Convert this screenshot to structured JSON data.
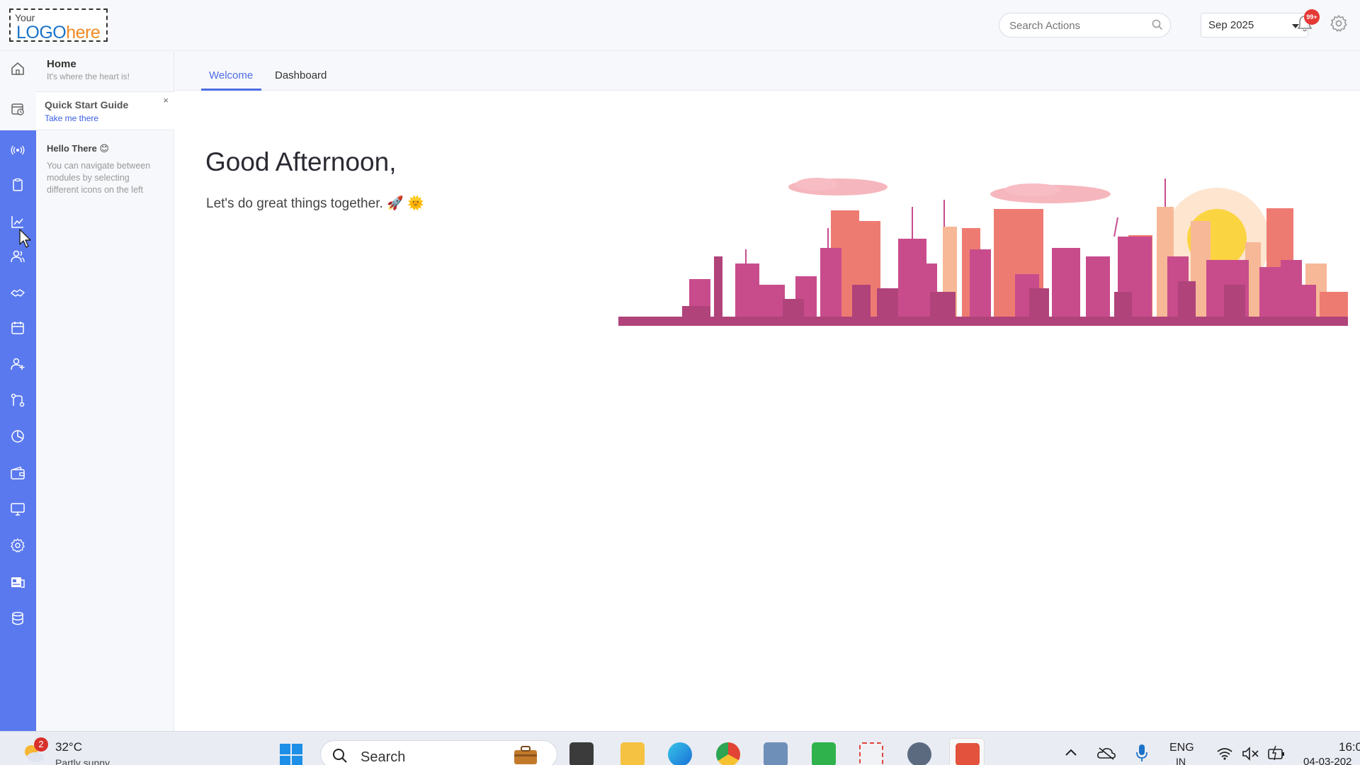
{
  "header": {
    "logo": {
      "line1": "Your",
      "logo_word": "LOGO",
      "logo_suffix": "here"
    },
    "search_placeholder": "Search Actions",
    "month": "Sep 2025",
    "notification_count": "99+"
  },
  "side_panel": {
    "home_title": "Home",
    "home_subtitle": "It's where the heart is!",
    "quick_start_title": "Quick Start Guide",
    "quick_start_link": "Take me there",
    "close_symbol": "×",
    "hello_title": "Hello There 😊",
    "hello_text": "You can navigate between modules by selecting different icons on the left"
  },
  "rail_icons": [
    "home-icon",
    "calendar-clock-icon",
    "broadcast-icon",
    "clipboard-icon",
    "line-chart-icon",
    "users-icon",
    "handshake-icon",
    "calendar-icon",
    "add-user-icon",
    "workflow-icon",
    "pie-chart-icon",
    "wallet-icon",
    "monitor-icon",
    "settings-cog-icon",
    "news-icon",
    "database-icon"
  ],
  "tabs": {
    "welcome": "Welcome",
    "dashboard": "Dashboard"
  },
  "main": {
    "greeting": "Good Afternoon,",
    "tagline": "Let's do great things together. 🚀 🌞"
  },
  "taskbar": {
    "weather_badge": "2",
    "temperature": "32°C",
    "condition": "Partly sunny",
    "search_label": "Search",
    "language_line1": "ENG",
    "language_line2": "IN",
    "time": "16:0",
    "date": "04-03-202"
  },
  "colors": {
    "rail": "#5a79ee",
    "accent": "#4d6de6",
    "badge": "#e53935"
  }
}
